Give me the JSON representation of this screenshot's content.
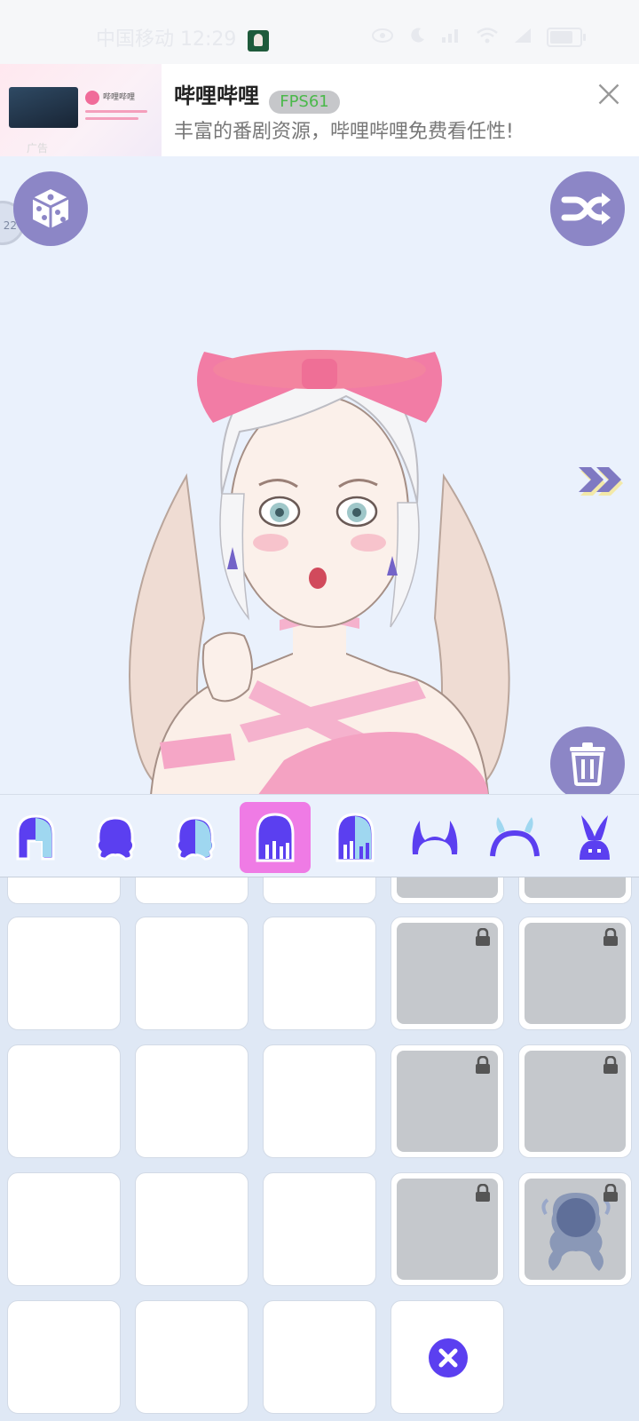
{
  "status_bar": {
    "carrier": "中国移动 12:29",
    "icons": [
      "eye-icon",
      "moon-icon",
      "signal-5g-icon",
      "wifi-icon",
      "signal-icon",
      "battery-icon"
    ]
  },
  "ad": {
    "title": "哔哩哔哩",
    "fps": "FPS61",
    "description": "丰富的番剧资源，哔哩哔哩免费看任性!",
    "label": "广告",
    "thumb_brand": "哔哩哔哩",
    "close_icon": "close-icon"
  },
  "stage": {
    "edge_badge": "22",
    "buttons": [
      "dice-icon",
      "shuffle-icon",
      "next-arrows-icon",
      "trash-icon"
    ]
  },
  "categories": {
    "selected_index": 3,
    "items": [
      "hair-full-icon",
      "hair-curly-icon",
      "hair-mixed-icon",
      "hair-back-icon",
      "hair-half-icon",
      "horns-icon",
      "antler-headband-icon",
      "bunny-ears-icon"
    ]
  },
  "grid": {
    "remove_icon": "close-circle-icon"
  },
  "colors": {
    "accent_purple": "#5b3ff0",
    "button_lavender": "#8c86c6",
    "selected_pink": "#ef7be5",
    "locked_gray": "#c5c8cc"
  }
}
